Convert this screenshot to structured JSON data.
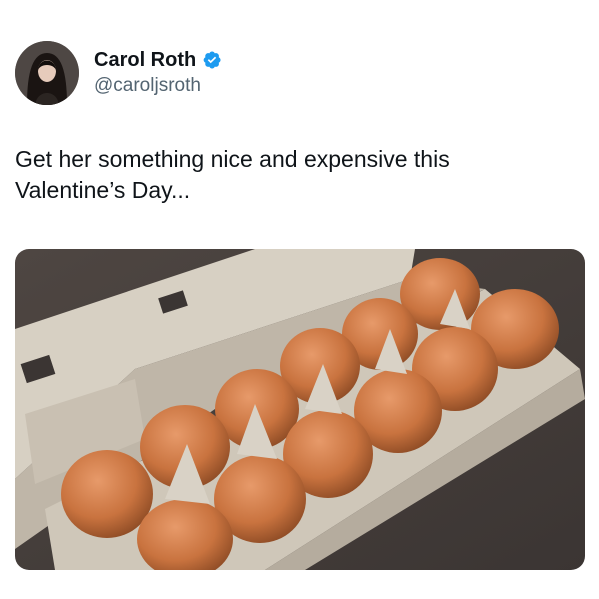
{
  "tweet": {
    "author": {
      "display_name": "Carol Roth",
      "handle": "@caroljsroth",
      "verified": true,
      "verified_icon": "verified-badge-icon",
      "avatar_icon": "profile-avatar"
    },
    "text": "Get her something nice and expensive this\nValentine’s Day...",
    "media": {
      "type": "photo",
      "subject": "eggs in carton"
    }
  },
  "colors": {
    "verified_blue": "#1d9bf0",
    "handle_gray": "#536471",
    "text": "#0f1419"
  }
}
